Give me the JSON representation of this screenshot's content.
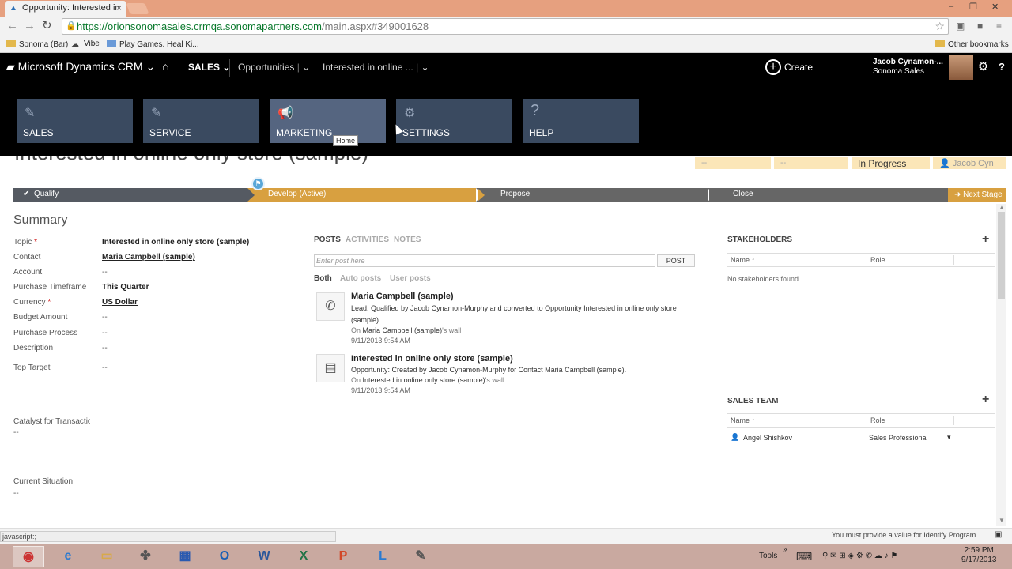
{
  "browser": {
    "tab_title": "Opportunity: Interested in",
    "url_host": "https://orionsonomasales.crmqa.sonomapartners.com",
    "url_path": "/main.aspx#349001628",
    "bookmarks": [
      "Sonoma (Bar)",
      "Vibe",
      "Play Games. Heal Ki..."
    ],
    "other_bookmarks": "Other bookmarks"
  },
  "crm_nav": {
    "app_name": "Microsoft Dynamics CRM",
    "area": "SALES",
    "entity": "Opportunities",
    "record": "Interested in online ...",
    "create": "Create",
    "user_name": "Jacob Cynamon-...",
    "user_org": "Sonoma Sales"
  },
  "sitemap": {
    "tiles": [
      {
        "label": "SALES",
        "icon": "sales-icon"
      },
      {
        "label": "SERVICE",
        "icon": "service-icon"
      },
      {
        "label": "MARKETING",
        "icon": "marketing-icon"
      },
      {
        "label": "SETTINGS",
        "icon": "settings-icon"
      },
      {
        "label": "HELP",
        "icon": "help-icon"
      }
    ],
    "tooltip": "Home"
  },
  "record": {
    "title": "Interested in online only store (sample)",
    "header_fields": [
      "--",
      "--",
      "In Progress",
      "Jacob Cyn"
    ]
  },
  "process": {
    "stages": [
      "Qualify",
      "Develop (Active)",
      "Propose",
      "Close"
    ],
    "next_stage": "Next Stage"
  },
  "summary": {
    "title": "Summary",
    "fields": [
      {
        "label": "Topic",
        "value": "Interested in online only store (sample)",
        "required": true
      },
      {
        "label": "Contact",
        "value": "Maria Campbell (sample)"
      },
      {
        "label": "Account",
        "value": "--"
      },
      {
        "label": "Purchase Timeframe",
        "value": "This Quarter"
      },
      {
        "label": "Currency",
        "value": "US Dollar",
        "required": true
      },
      {
        "label": "Budget Amount",
        "value": "--"
      },
      {
        "label": "Purchase Process",
        "value": "--"
      },
      {
        "label": "Description",
        "value": "--"
      },
      {
        "label": "Top Target",
        "value": "--"
      }
    ],
    "catalyst_label": "Catalyst for Transactio",
    "catalyst_value": "--",
    "situation_label": "Current Situation",
    "situation_value": "--"
  },
  "social": {
    "tabs": [
      "POSTS",
      "ACTIVITIES",
      "NOTES"
    ],
    "post_placeholder": "Enter post here",
    "post_button": "POST",
    "filters": [
      "Both",
      "Auto posts",
      "User posts"
    ],
    "posts": [
      {
        "title": "Maria Campbell (sample)",
        "text": "Lead: Qualified by Jacob Cynamon-Murphy and converted to Opportunity Interested in online only store (sample).",
        "wall_prefix": "On",
        "wall_link": "Maria Campbell (sample)",
        "wall_suffix": "'s wall",
        "time": "9/11/2013 9:54 AM"
      },
      {
        "title": "Interested in online only store (sample)",
        "text": "Opportunity: Created by Jacob Cynamon-Murphy for Contact Maria Campbell (sample).",
        "wall_prefix": "On",
        "wall_link": "Interested in online only store (sample)",
        "wall_suffix": "'s wall",
        "time": "9/11/2013 9:54 AM"
      }
    ]
  },
  "stakeholders": {
    "title": "STAKEHOLDERS",
    "col_name": "Name",
    "col_role": "Role",
    "empty": "No stakeholders found."
  },
  "sales_team": {
    "title": "SALES TEAM",
    "col_name": "Name",
    "col_role": "Role",
    "member_name": "Angel Shishkov",
    "member_role": "Sales Professional"
  },
  "status": {
    "link": "javascript:;",
    "notification": "You must provide a value for Identify Program."
  },
  "taskbar": {
    "tools": "Tools",
    "time": "2:59 PM",
    "date": "9/17/2013"
  },
  "colors": {
    "accent": "#d8a040",
    "nav": "#000000",
    "tile": "#3a4a60"
  }
}
